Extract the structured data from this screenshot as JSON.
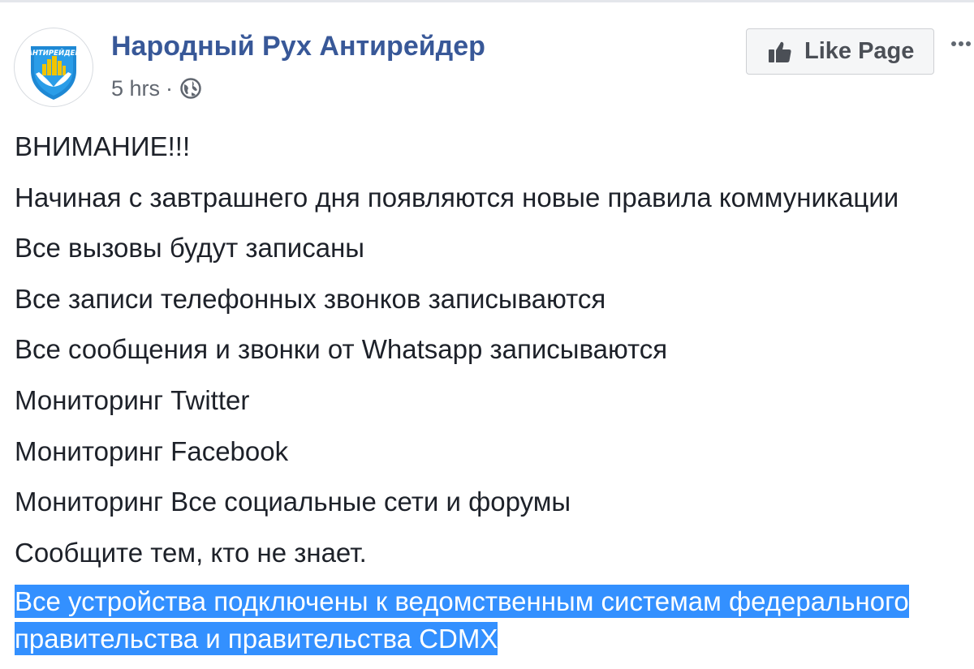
{
  "post": {
    "page_name": "Народный Рух Антирейдер",
    "avatar_text": "АНТИРЕЙДЕР",
    "time": "5 hrs",
    "separator": "·",
    "audience_icon": "globe-icon",
    "like_button_label": "Like Page",
    "like_icon": "thumbs-up-icon",
    "more_icon": "more-options-icon",
    "lines": [
      "ВНИМАНИЕ!!!",
      "Начиная с завтрашнего дня появляются новые правила коммуникации",
      "Все вызовы будут записаны",
      "Все записи телефонных звонков записываются",
      "Все сообщения и звонки от Whatsapp записываются",
      "Мониторинг Twitter",
      "Мониторинг Facebook",
      "Мониторинг Все социальные сети и форумы",
      "Сообщите тем, кто не знает."
    ],
    "highlighted_lines": [
      "Все устройства подключены к ведомственным системам федерального",
      "правительства и правительства CDMX"
    ]
  },
  "colors": {
    "page_name": "#385898",
    "meta_text": "#616770",
    "body_text": "#1d2129",
    "selection_bg": "#3390ff",
    "selection_text": "#ffffff",
    "like_button_bg": "#f5f6f7"
  }
}
